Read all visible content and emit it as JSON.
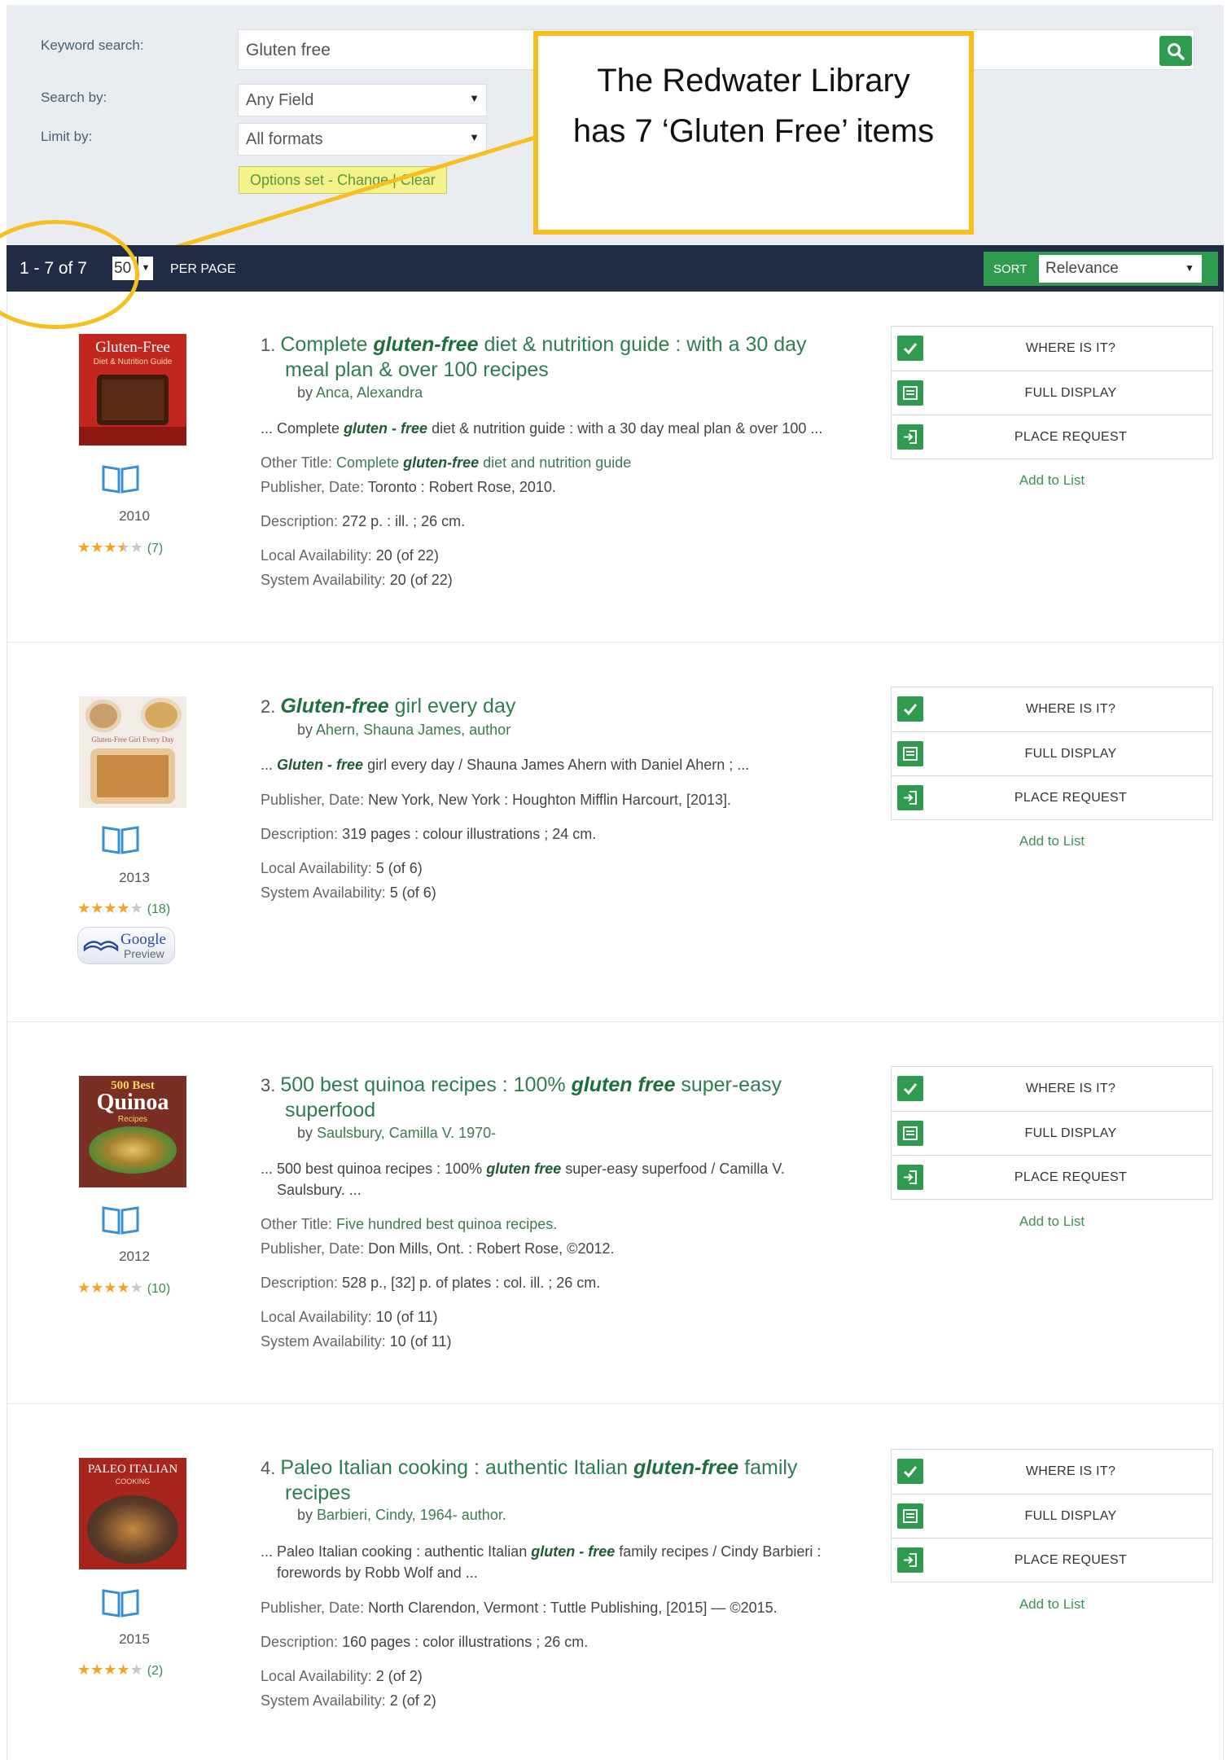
{
  "search": {
    "keyword_label": "Keyword search:",
    "keyword_value": "Gluten free",
    "search_by_label": "Search by:",
    "search_by_value": "Any Field",
    "limit_by_label": "Limit by:",
    "limit_by_value": "All formats",
    "options_text": "Options set - Change | Clear"
  },
  "callout": {
    "line1": "The Redwater Library",
    "line2": "has 7 ‘Gluten Free’ items"
  },
  "results_bar": {
    "count": "1 - 7 of 7",
    "per_page_value": "50",
    "per_page_label": "PER PAGE",
    "sort_label": "SORT",
    "sort_value": "Relevance"
  },
  "labels": {
    "by": "by",
    "other_title": "Other Title:",
    "publisher": "Publisher, Date:",
    "description": "Description:",
    "local": "Local Availability:",
    "system": "System Availability:",
    "where": "WHERE IS IT?",
    "full": "FULL DISPLAY",
    "request": "PLACE REQUEST",
    "add_to_list": "Add to List",
    "google": "Google",
    "preview": "Preview"
  },
  "results": [
    {
      "number": "1.",
      "title_pre": "Complete",
      "title_em": "gluten-free",
      "title_post": "diet & nutrition guide : with a 30 day",
      "title_line2": "meal plan & over 100 recipes",
      "author": "Anca, Alexandra",
      "snippet_pre": "... Complete",
      "snippet_em": "gluten - free",
      "snippet_post": "diet & nutrition guide : with a 30 day meal plan & over 100 ...",
      "snippet_line2": "",
      "other_title_pre": "Complete",
      "other_title_em": "gluten-free",
      "other_title_post": "diet and nutrition guide",
      "publisher": "Toronto : Robert Rose, 2010.",
      "description": "272 p. : ill. ; 26 cm.",
      "local": "20 (of 22)",
      "system": "20 (of 22)",
      "year": "2010",
      "rating": 3.5,
      "rating_count": "(7)",
      "cover_title": "Gluten-Free",
      "cover_sub": "Diet & Nutrition Guide"
    },
    {
      "number": "2.",
      "title_pre": "",
      "title_em": "Gluten-free",
      "title_post": "girl every day",
      "title_line2": "",
      "author": "Ahern, Shauna James, author",
      "snippet_pre": "...",
      "snippet_em": "Gluten - free",
      "snippet_post": "girl every day / Shauna James Ahern with Daniel Ahern ; ...",
      "snippet_line2": "",
      "publisher": "New York, New York : Houghton Mifflin Harcourt, [2013].",
      "description": "319 pages : colour illustrations ; 24 cm.",
      "local": "5 (of 6)",
      "system": "5 (of 6)",
      "year": "2013",
      "rating": 4,
      "rating_count": "(18)",
      "cover_title": "Gluten-Free Girl Every Day"
    },
    {
      "number": "3.",
      "title_pre": "500 best quinoa recipes : 100%",
      "title_em": "gluten free",
      "title_post": "super-easy",
      "title_line2": "superfood",
      "author": "Saulsbury, Camilla V. 1970-",
      "snippet_pre": "... 500 best quinoa recipes : 100%",
      "snippet_em": "gluten free",
      "snippet_post": "super-easy superfood / Camilla V.",
      "snippet_line2": "Saulsbury. ...",
      "other_title": "Five hundred best quinoa recipes.",
      "publisher": "Don Mills, Ont. : Robert Rose, ©2012.",
      "description": "528 p., [32] p. of plates : col. ill. ; 26 cm.",
      "local": "10 (of 11)",
      "system": "10 (of 11)",
      "year": "2012",
      "rating": 4,
      "rating_count": "(10)",
      "cover_top": "500 Best",
      "cover_title": "Quinoa",
      "cover_sub": "Recipes"
    },
    {
      "number": "4.",
      "title_pre": "Paleo Italian cooking : authentic Italian",
      "title_em": "gluten-free",
      "title_post": "family",
      "title_line2": "recipes",
      "author": "Barbieri, Cindy, 1964- author.",
      "snippet_pre": "... Paleo Italian cooking : authentic Italian",
      "snippet_em": "gluten - free",
      "snippet_post": "family recipes / Cindy Barbieri :",
      "snippet_line2": "forewords by Robb Wolf and ...",
      "publisher": "North Clarendon, Vermont : Tuttle Publishing, [2015] — ©2015.",
      "description": "160 pages : color illustrations ; 26 cm.",
      "local": "2 (of 2)",
      "system": "2 (of 2)",
      "year": "2015",
      "rating": 4,
      "rating_count": "(2)",
      "cover_title": "PALEO ITALIAN",
      "cover_sub": "COOKING"
    }
  ],
  "colors": {
    "accent_green": "#2e9b4e",
    "bar_navy": "#1f2c43",
    "callout_yellow": "#f6bf1f",
    "link_green": "#2e7d4f"
  }
}
